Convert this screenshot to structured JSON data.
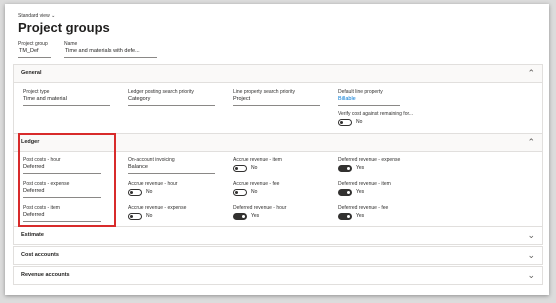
{
  "header": {
    "view_switch": "Standard view",
    "title": "Project groups",
    "fields": [
      {
        "label": "Project group",
        "value": "TM_Def"
      },
      {
        "label": "Name",
        "value": "Time and materials with defe..."
      }
    ]
  },
  "sections": {
    "general": {
      "title": "General",
      "fields": {
        "project_type": {
          "label": "Project type",
          "value": "Time and material"
        },
        "ledger_posting_priority": {
          "label": "Ledger posting search priority",
          "value": "Category"
        },
        "line_property_priority": {
          "label": "Line property search priority",
          "value": "Project"
        },
        "default_line_property": {
          "label": "Default line property",
          "value": "Billable"
        },
        "verify_cost": {
          "label": "Verify cost against remaining for...",
          "toggle": "No"
        }
      }
    },
    "ledger": {
      "title": "Ledger",
      "fields": {
        "post_costs_hour": {
          "label": "Post costs - hour",
          "value": "Deferred"
        },
        "post_costs_expense": {
          "label": "Post costs - expense",
          "value": "Deferred"
        },
        "post_costs_item": {
          "label": "Post costs - item",
          "value": "Deferred"
        },
        "on_account_invoicing": {
          "label": "On-account invoicing",
          "value": "Balance"
        },
        "accrue_revenue_hour": {
          "label": "Accrue revenue - hour",
          "toggle": "No"
        },
        "accrue_revenue_expense": {
          "label": "Accrue revenue - expense",
          "toggle": "No"
        },
        "accrue_revenue_item": {
          "label": "Accrue revenue - item",
          "toggle": "No"
        },
        "accrue_revenue_fee": {
          "label": "Accrue revenue - fee",
          "toggle": "No"
        },
        "deferred_revenue_hour": {
          "label": "Deferred revenue - hour",
          "toggle": "Yes"
        },
        "deferred_revenue_expense": {
          "label": "Deferred revenue - expense",
          "toggle": "Yes"
        },
        "deferred_revenue_item": {
          "label": "Deferred revenue - item",
          "toggle": "Yes"
        },
        "deferred_revenue_fee": {
          "label": "Deferred revenue - fee",
          "toggle": "Yes"
        }
      }
    },
    "estimate": {
      "title": "Estimate"
    },
    "cost_accounts": {
      "title": "Cost accounts"
    },
    "revenue_accounts": {
      "title": "Revenue accounts"
    }
  },
  "icons": {
    "chevron_up": "chevron-up-icon",
    "chevron_down": "chevron-down-icon"
  },
  "colors": {
    "highlight": "#d82b2b",
    "link": "#0078d4"
  }
}
